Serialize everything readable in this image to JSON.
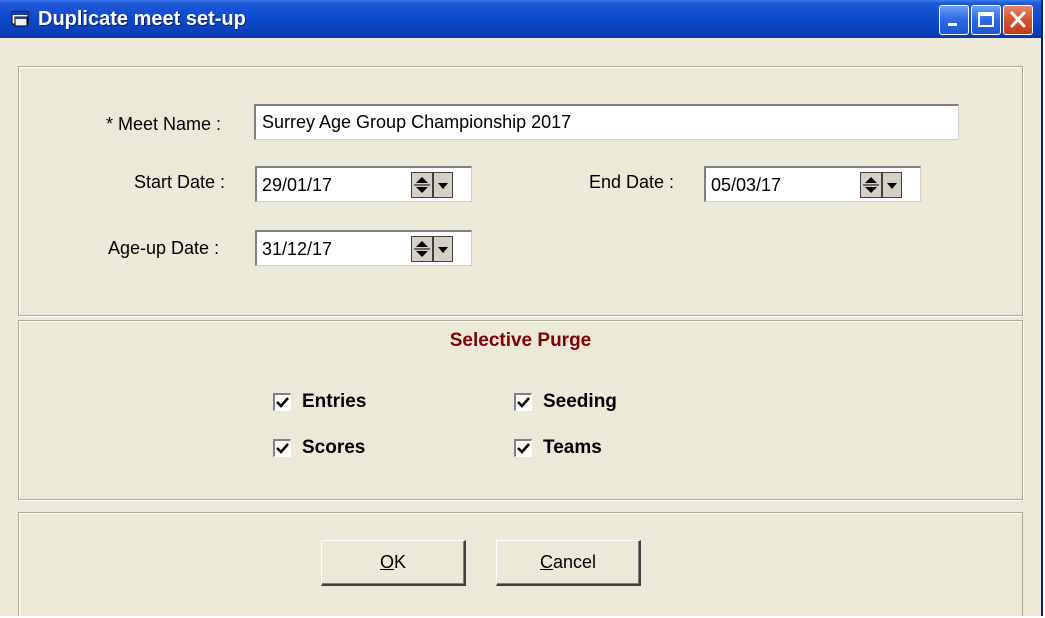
{
  "window": {
    "title": "Duplicate meet set-up"
  },
  "form": {
    "meet_name_label": "* Meet Name :",
    "meet_name_value": "Surrey Age Group Championship 2017",
    "start_date_label": "Start Date :",
    "start_date_value": "29/01/17",
    "end_date_label": "End Date :",
    "end_date_value": "05/03/17",
    "ageup_date_label": "Age-up Date :",
    "ageup_date_value": "31/12/17"
  },
  "purge": {
    "title": "Selective Purge",
    "options": [
      {
        "label": "Entries",
        "checked": true
      },
      {
        "label": "Seeding",
        "checked": true
      },
      {
        "label": "Scores",
        "checked": true
      },
      {
        "label": "Teams",
        "checked": true
      }
    ]
  },
  "buttons": {
    "ok_mnemonic": "O",
    "ok_rest": "K",
    "cancel_mnemonic": "C",
    "cancel_rest": "ancel"
  },
  "icons": [
    "app-icon",
    "minimize-icon",
    "maximize-icon",
    "close-icon",
    "spin-arrows-icon",
    "dropdown-arrow-icon",
    "checkmark-icon"
  ]
}
